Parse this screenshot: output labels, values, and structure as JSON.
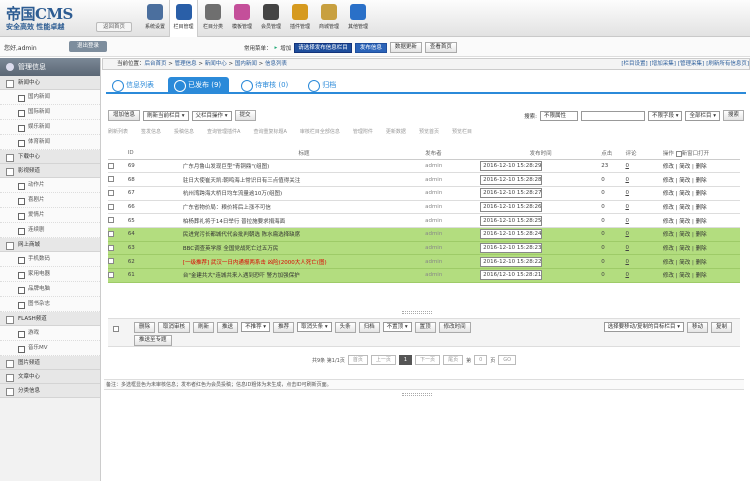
{
  "header": {
    "logo": "帝国CMS",
    "slogan": "安全高效 性能卓越",
    "back_home": "返回首页",
    "nav": [
      {
        "label": "系统设置",
        "color": "#4b6f9e"
      },
      {
        "label": "栏目管理",
        "color": "#2a5fa8"
      },
      {
        "label": "栏目分类",
        "color": "#6f6f6f"
      },
      {
        "label": "模板管理",
        "color": "#c44f9a"
      },
      {
        "label": "会员管理",
        "color": "#444"
      },
      {
        "label": "插件管理",
        "color": "#d69a1f"
      },
      {
        "label": "商城管理",
        "color": "#c8a040"
      },
      {
        "label": "其他管理",
        "color": "#2a70c8"
      }
    ],
    "active_nav": 1
  },
  "userbar": {
    "user": "您好,admin",
    "logout": "退出登录",
    "quick_label": "常用菜单：",
    "add": "增加",
    "column_select": "请选择发布信息栏目",
    "publish": "发布信息",
    "update": "数据更新",
    "view_home": "查看首页"
  },
  "sidebar": {
    "title": "管理信息",
    "groups": [
      {
        "label": "新闻中心",
        "items": [
          "国内新闻",
          "国际新闻",
          "娱乐新闻",
          "体育新闻"
        ]
      },
      {
        "label": "下载中心",
        "items": []
      },
      {
        "label": "影视频道",
        "items": [
          "动作片",
          "喜剧片",
          "爱情片",
          "连续剧"
        ]
      },
      {
        "label": "网上商城",
        "items": [
          "手机数码",
          "家用电器",
          "品牌电脑",
          "图书杂志"
        ]
      },
      {
        "label": "FLASH频道",
        "items": [
          "游戏",
          "音乐MV"
        ]
      },
      {
        "label": "图片频道",
        "items": []
      },
      {
        "label": "文章中心",
        "items": []
      },
      {
        "label": "分类信息",
        "items": []
      }
    ]
  },
  "breadcrumb": {
    "prefix": "当前位置：",
    "path": [
      "后台首页",
      "管理信息",
      "新闻中心",
      "国内新闻",
      "信息列表"
    ],
    "right": [
      "[栏目设置]",
      "[增加采集]",
      "[管理采集]",
      "[刷新所有信息页]"
    ]
  },
  "tabs": [
    {
      "label": "信息列表",
      "active": false
    },
    {
      "label": "已发布 (9)",
      "active": true
    },
    {
      "label": "待审核 (0)",
      "active": false
    },
    {
      "label": "归档",
      "active": false
    }
  ],
  "toolbar": {
    "add": "增加信息",
    "refresh": "刷新当前栏目 ▾",
    "column": "父栏目操作 ▾",
    "submit": "提交",
    "search_label": "搜索:",
    "search_attr": "不限属性",
    "search_field": "不限字段 ▾",
    "search_column": "全部栏目 ▾",
    "search_btn": "搜索"
  },
  "col_actions": [
    "刷新列表",
    "签发信息",
    "投稿信息",
    "查询管理插件A",
    "查询重复标题A",
    "审核栏目全部信息",
    "管理附件",
    "更新数据",
    "预览首页",
    "预览栏目"
  ],
  "table": {
    "headers": [
      "",
      "ID",
      "标题",
      "发布者",
      "发布时间",
      "点击",
      "评论",
      "操作"
    ],
    "new_window": "新窗口打开",
    "rows": [
      {
        "id": "69",
        "title": "广东月鲁山发现巨型\"青铜鼎\"(组图)",
        "user": "admin",
        "time": "2016-12-10 15:28:29",
        "clicks": "23",
        "comments": "0",
        "green": false
      },
      {
        "id": "68",
        "title": "驻日大使崔天凯:朝鸣海上常识日有三点值得关注",
        "user": "admin",
        "time": "2016-12-10 15:28:28",
        "clicks": "0",
        "comments": "0",
        "green": false
      },
      {
        "id": "67",
        "title": "杭州湾跨海大桥日均车流量逾10万(组图)",
        "user": "admin",
        "time": "2016-12-10 15:28:27",
        "clicks": "0",
        "comments": "0",
        "green": false
      },
      {
        "id": "66",
        "title": "广东省物价局：粮价将后上涨不可信",
        "user": "admin",
        "time": "2016-12-10 15:28:26",
        "clicks": "0",
        "comments": "0",
        "green": false
      },
      {
        "id": "65",
        "title": "柏杨葬礼将于14日举行 普拉施要求捐海面",
        "user": "admin",
        "time": "2016-12-10 15:28:25",
        "clicks": "0",
        "comments": "0",
        "green": false
      },
      {
        "id": "64",
        "title": "民进党污长都城代代会批判朝选 陈水扁选择缺席",
        "user": "admin",
        "time": "2016-12-10 15:28:24",
        "clicks": "0",
        "comments": "0",
        "green": true
      },
      {
        "id": "63",
        "title": "BBC调查英学原 全国党战死亡过五万民",
        "user": "admin",
        "time": "2016-12-10 15:28:23",
        "clicks": "0",
        "comments": "0",
        "green": true,
        "red": false
      },
      {
        "id": "62",
        "title": "[一级推荐] 武汉一日内通报两系击 凶险(2000大人死亡(图)",
        "user": "admin",
        "time": "2016-12-10 15:28:22",
        "clicks": "0",
        "comments": "0",
        "green": true,
        "red": true
      },
      {
        "id": "61",
        "title": "台\"金建共大\"连城共来入遇到恐吓 警方加强保护",
        "user": "admin",
        "time": "2016/12-10 15:28:21",
        "clicks": "0",
        "comments": "0",
        "green": true
      }
    ],
    "ops": [
      "修改",
      "简改",
      "删除"
    ]
  },
  "actions": {
    "row1": [
      "删除",
      "取消审核",
      "刷新",
      "推送",
      "不推荐 ▾",
      "推荐",
      "取消头条 ▾",
      "头条",
      "归档",
      "不置顶 ▾",
      "置顶",
      "修改时间"
    ],
    "row2": [
      "推送至专题"
    ],
    "move_select": "选择要移动/复制的目标栏目 ▾",
    "move": "移动",
    "copy": "复制"
  },
  "pager": {
    "info": "共9条 第1/1页",
    "first": "首页",
    "prev": "上一页",
    "current": "1",
    "next": "下一页",
    "last": "尾页",
    "goto_pre": "第",
    "goto_val": "0",
    "goto_post": "页",
    "go": "GO"
  },
  "note": "备注：多选框显色为未审核信息；发布者红色为会员投稿；信息ID粗体为未生成，点击ID可刷新页面。"
}
